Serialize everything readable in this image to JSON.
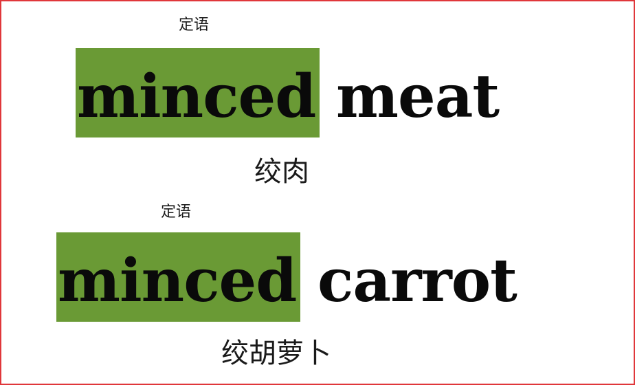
{
  "colors": {
    "highlight": "#6a9a35",
    "border": "#e0373b",
    "text": "#0a0a0a"
  },
  "example1": {
    "label": "定语",
    "modifier": "minced",
    "noun": "meat",
    "translation": "绞肉"
  },
  "example2": {
    "label": "定语",
    "modifier": "minced",
    "noun": "carrot",
    "translation": "绞胡萝卜"
  }
}
